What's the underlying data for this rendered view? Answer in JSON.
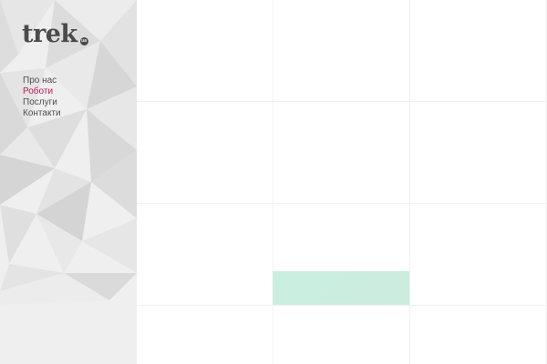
{
  "logo": {
    "text": "trek",
    "badge": "ua"
  },
  "nav": {
    "items": [
      {
        "label": "Про нас",
        "active": false
      },
      {
        "label": "Роботи",
        "active": true
      },
      {
        "label": "Послуги",
        "active": false
      },
      {
        "label": "Контакти",
        "active": false
      }
    ]
  },
  "colors": {
    "accent": "#c3185a",
    "sidebar_bg": "#efefef",
    "nav_text": "#4f4f4f",
    "tile": "#c9efe0"
  }
}
